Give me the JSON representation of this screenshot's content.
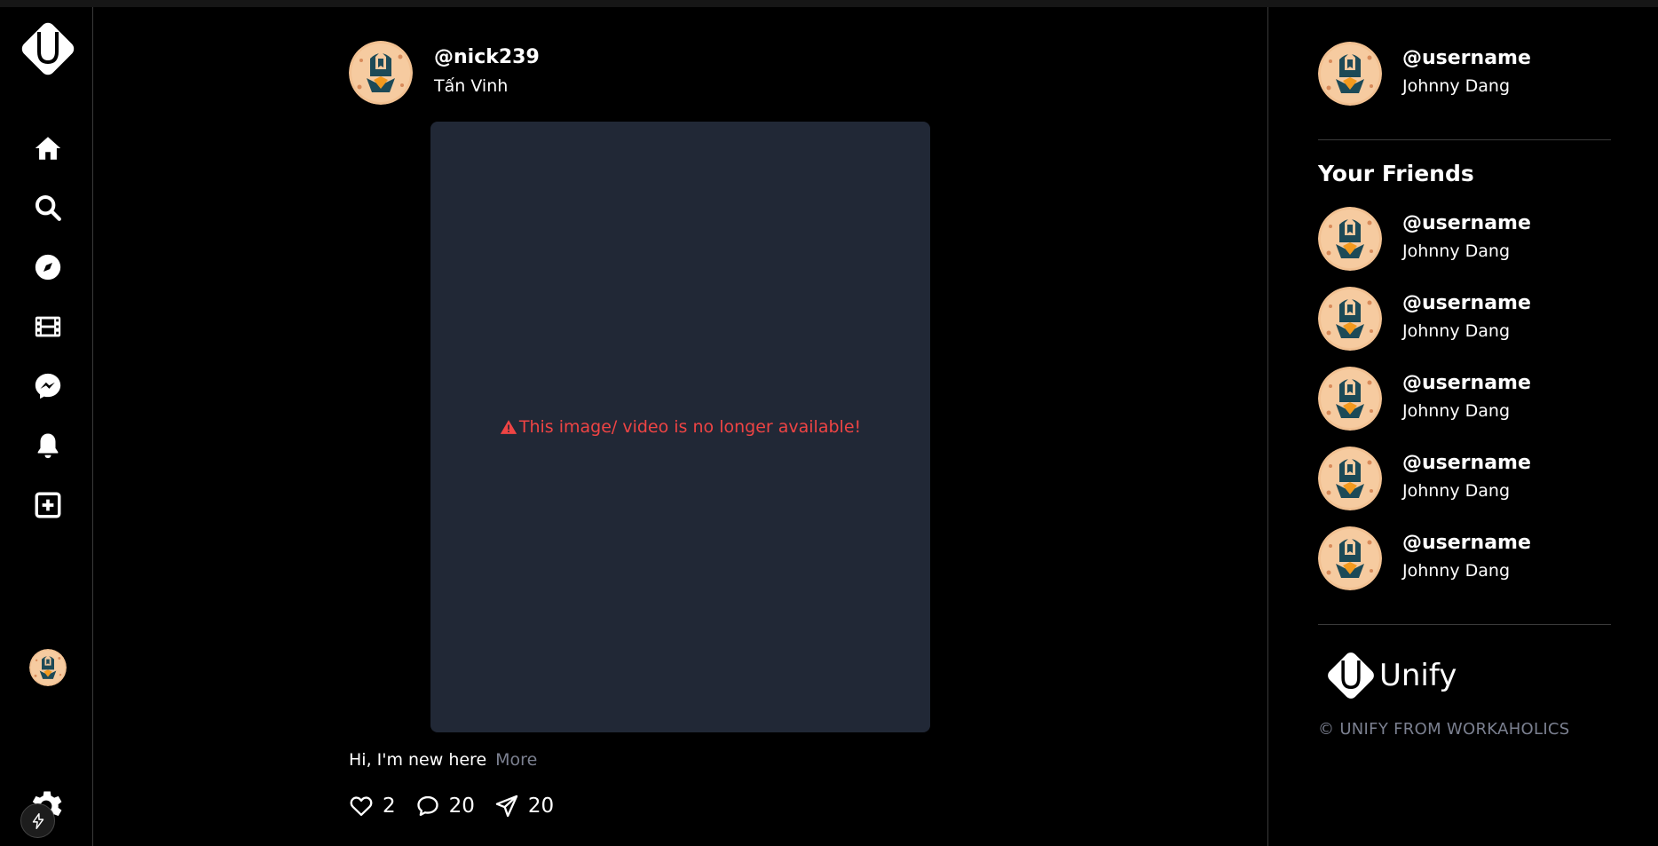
{
  "post": {
    "username": "@nick239",
    "fullname": "Tấn Vinh",
    "media_error": "This image/ video is no longer available!",
    "caption": "Hi, I'm new here",
    "more_label": "More",
    "likes": "2",
    "comments": "20",
    "shares": "20"
  },
  "profile": {
    "username": "@username",
    "fullname": "Johnny Dang"
  },
  "friends": {
    "title": "Your Friends",
    "items": [
      {
        "username": "@username",
        "fullname": "Johnny Dang"
      },
      {
        "username": "@username",
        "fullname": "Johnny Dang"
      },
      {
        "username": "@username",
        "fullname": "Johnny Dang"
      },
      {
        "username": "@username",
        "fullname": "Johnny Dang"
      },
      {
        "username": "@username",
        "fullname": "Johnny Dang"
      }
    ]
  },
  "footer": {
    "brand": "Unify",
    "copyright": "© UNIFY FROM WORKAHOLICS"
  },
  "nav": {
    "items": [
      "home-icon",
      "search-icon",
      "compass-icon",
      "film-icon",
      "messenger-icon",
      "bell-icon",
      "plus-square-icon",
      "avatar",
      "gear-icon"
    ]
  },
  "colors": {
    "background": "#000000",
    "media_placeholder": "#212836",
    "error": "#ef4444",
    "muted": "#7b8090"
  }
}
